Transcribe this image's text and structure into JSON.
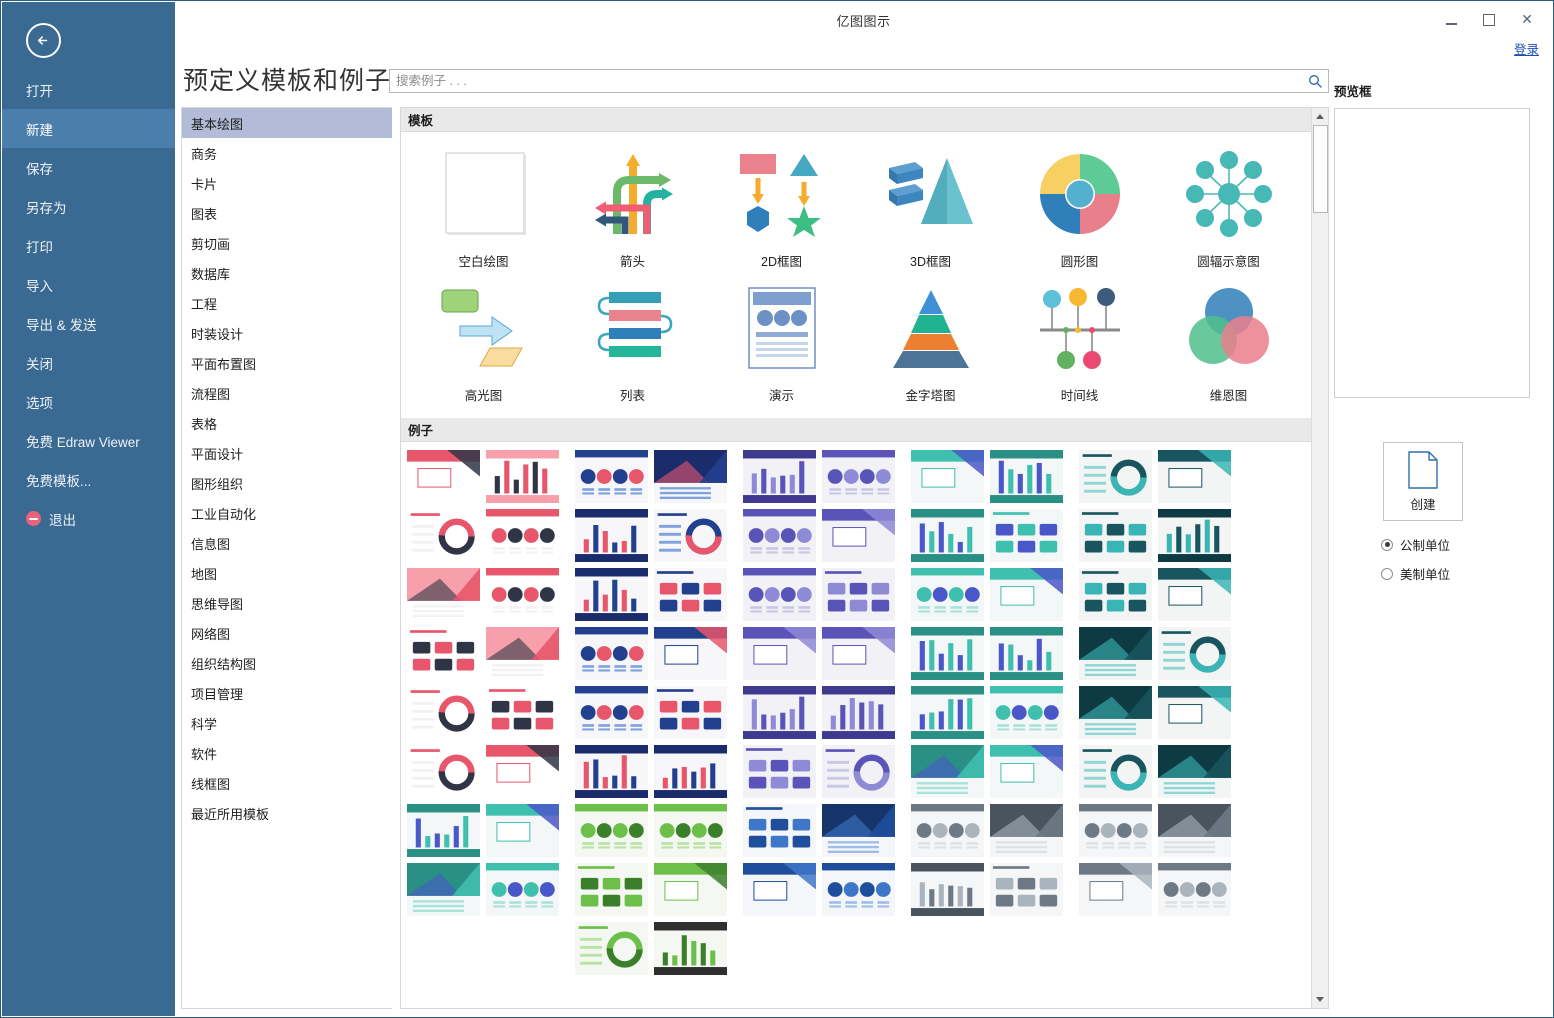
{
  "window": {
    "title": "亿图图示",
    "controls": {
      "minimize": "–",
      "maximize": "□",
      "close": "✕"
    }
  },
  "sidebar": {
    "back_icon": "back-arrow-icon",
    "items": [
      {
        "label": "打开",
        "icon": null,
        "active": false
      },
      {
        "label": "新建",
        "icon": null,
        "active": true
      },
      {
        "label": "保存",
        "icon": null,
        "active": false
      },
      {
        "label": "另存为",
        "icon": null,
        "active": false
      },
      {
        "label": "打印",
        "icon": null,
        "active": false
      },
      {
        "label": "导入",
        "icon": null,
        "active": false
      },
      {
        "label": "导出 & 发送",
        "icon": null,
        "active": false
      },
      {
        "label": "关闭",
        "icon": null,
        "active": false
      },
      {
        "label": "选项",
        "icon": null,
        "active": false
      },
      {
        "label": "免费 Edraw Viewer",
        "icon": null,
        "active": false
      },
      {
        "label": "免费模板...",
        "icon": null,
        "active": false
      },
      {
        "label": "退出",
        "icon": "exit-icon",
        "active": false
      }
    ]
  },
  "header": {
    "page_title": "预定义模板和例子",
    "login_label": "登录"
  },
  "search": {
    "placeholder": "搜索例子 . . .",
    "value": "",
    "icon": "search-icon"
  },
  "categories": {
    "items": [
      {
        "label": "基本绘图",
        "active": true
      },
      {
        "label": "商务",
        "active": false
      },
      {
        "label": "卡片",
        "active": false
      },
      {
        "label": "图表",
        "active": false
      },
      {
        "label": "剪切画",
        "active": false
      },
      {
        "label": "数据库",
        "active": false
      },
      {
        "label": "工程",
        "active": false
      },
      {
        "label": "时装设计",
        "active": false
      },
      {
        "label": "平面布置图",
        "active": false
      },
      {
        "label": "流程图",
        "active": false
      },
      {
        "label": "表格",
        "active": false
      },
      {
        "label": "平面设计",
        "active": false
      },
      {
        "label": "图形组织",
        "active": false
      },
      {
        "label": "工业自动化",
        "active": false
      },
      {
        "label": "信息图",
        "active": false
      },
      {
        "label": "地图",
        "active": false
      },
      {
        "label": "思维导图",
        "active": false
      },
      {
        "label": "网络图",
        "active": false
      },
      {
        "label": "组织结构图",
        "active": false
      },
      {
        "label": "项目管理",
        "active": false
      },
      {
        "label": "科学",
        "active": false
      },
      {
        "label": "软件",
        "active": false
      },
      {
        "label": "线框图",
        "active": false
      },
      {
        "label": "最近所用模板",
        "active": false
      }
    ]
  },
  "templates_section": {
    "heading": "模板",
    "items": [
      {
        "label": "空白绘图",
        "art": "blank-page"
      },
      {
        "label": "箭头",
        "art": "arrows"
      },
      {
        "label": "2D框图",
        "art": "block2d"
      },
      {
        "label": "3D框图",
        "art": "block3d"
      },
      {
        "label": "圆形图",
        "art": "donut"
      },
      {
        "label": "圆辐示意图",
        "art": "radial"
      },
      {
        "label": "高光图",
        "art": "highlight"
      },
      {
        "label": "列表",
        "art": "list"
      },
      {
        "label": "演示",
        "art": "presentation"
      },
      {
        "label": "金字塔图",
        "art": "pyramid"
      },
      {
        "label": "时间线",
        "art": "timeline"
      },
      {
        "label": "维恩图",
        "art": "venn"
      }
    ]
  },
  "examples_section": {
    "heading": "例子"
  },
  "preview": {
    "label": "预览框"
  },
  "actions": {
    "create_label": "创建",
    "create_icon": "document-icon",
    "units": [
      {
        "label": "公制单位",
        "selected": true
      },
      {
        "label": "美制单位",
        "selected": false
      }
    ]
  },
  "colors": {
    "sidebar_bg": "#3a6992",
    "sidebar_active": "#4a7fac",
    "category_active": "#b2bcd8",
    "section_head_bg": "#e9e9e9",
    "link": "#1a4fb4",
    "exit_icon": "#e8637a"
  }
}
